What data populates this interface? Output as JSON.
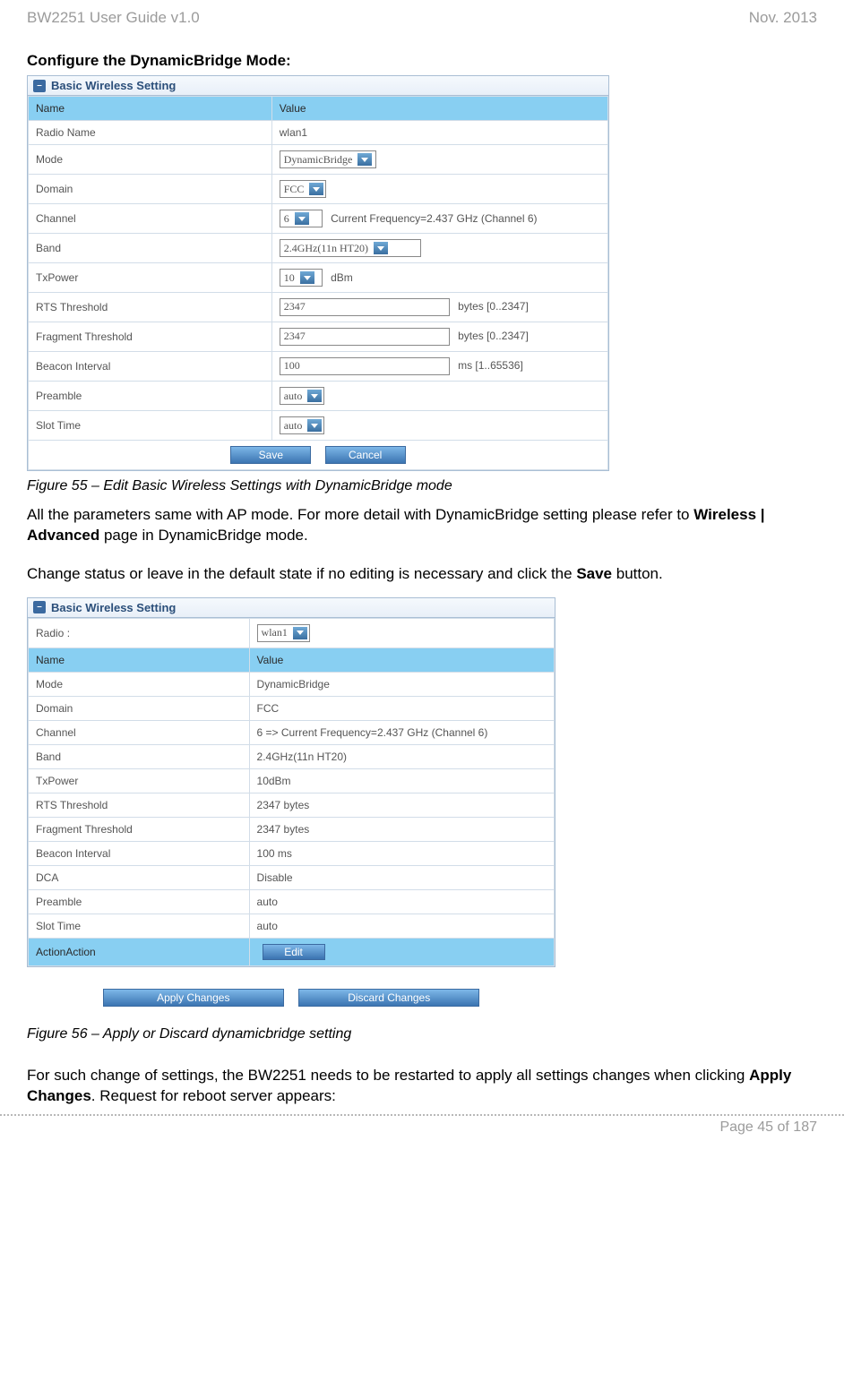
{
  "header": {
    "left": "BW2251 User Guide v1.0",
    "right": "Nov.  2013"
  },
  "section_heading": "Configure the DynamicBridge Mode:",
  "panel_title": "Basic Wireless Setting",
  "table1": {
    "header": {
      "name": "Name",
      "value": "Value"
    },
    "rows": [
      {
        "label": "Radio Name",
        "type": "text",
        "value": "wlan1"
      },
      {
        "label": "Mode",
        "type": "select",
        "value": "DynamicBridge"
      },
      {
        "label": "Domain",
        "type": "select",
        "value": "FCC"
      },
      {
        "label": "Channel",
        "type": "select",
        "value": "6",
        "after": "Current Frequency=2.437 GHz (Channel 6)"
      },
      {
        "label": "Band",
        "type": "select_wide",
        "value": "2.4GHz(11n HT20)"
      },
      {
        "label": "TxPower",
        "type": "select",
        "value": "10",
        "after": "dBm"
      },
      {
        "label": "RTS Threshold",
        "type": "input",
        "value": "2347",
        "after": "bytes [0..2347]"
      },
      {
        "label": "Fragment Threshold",
        "type": "input",
        "value": "2347",
        "after": "bytes [0..2347]"
      },
      {
        "label": "Beacon Interval",
        "type": "input",
        "value": "100",
        "after": "ms [1..65536]"
      },
      {
        "label": "Preamble",
        "type": "select",
        "value": "auto"
      },
      {
        "label": "Slot Time",
        "type": "select",
        "value": "auto"
      }
    ],
    "buttons": {
      "save": "Save",
      "cancel": "Cancel"
    }
  },
  "caption1": "Figure 55 – Edit Basic Wireless Settings with DynamicBridge mode",
  "para1_a": "All the parameters same with AP mode. For more detail with DynamicBridge setting please refer to ",
  "para1_b": "Wireless | Advanced",
  "para1_c": " page in DynamicBridge mode.",
  "para2_a": "Change status or leave in the default state if no editing is necessary and click the ",
  "para2_b": "Save",
  "para2_c": " button.",
  "table2": {
    "radio_row": {
      "label": "Radio :",
      "value": "wlan1"
    },
    "header": {
      "name": "Name",
      "value": "Value"
    },
    "rows": [
      {
        "label": "Mode",
        "value": "DynamicBridge"
      },
      {
        "label": "Domain",
        "value": "FCC"
      },
      {
        "label": "Channel",
        "value": "6 =>  Current Frequency=2.437 GHz (Channel 6)"
      },
      {
        "label": "Band",
        "value": "2.4GHz(11n HT20)"
      },
      {
        "label": "TxPower",
        "value": "10dBm"
      },
      {
        "label": "RTS Threshold",
        "value": "2347 bytes"
      },
      {
        "label": "Fragment Threshold",
        "value": "2347 bytes"
      },
      {
        "label": "Beacon Interval",
        "value": "100 ms"
      },
      {
        "label": "DCA",
        "value": "Disable"
      },
      {
        "label": "Preamble",
        "value": "auto"
      },
      {
        "label": "Slot Time",
        "value": "auto"
      }
    ],
    "action_row": {
      "label": "ActionAction",
      "button": "Edit"
    },
    "buttons": {
      "apply": "Apply Changes",
      "discard": "Discard Changes"
    }
  },
  "caption2": "Figure 56 – Apply or Discard dynamicbridge setting",
  "para3_a": "For such change of settings, the BW2251 needs to be restarted to apply all settings changes when clicking ",
  "para3_b": "Apply Changes",
  "para3_c": ". Request for reboot server appears:",
  "footer": "Page 45 of 187"
}
